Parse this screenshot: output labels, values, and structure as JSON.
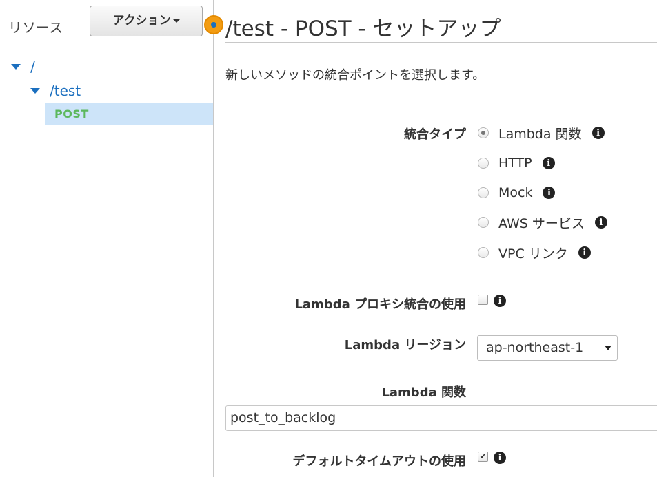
{
  "sidebar": {
    "title": "リソース",
    "action_button": "アクション",
    "tree": {
      "root": "/",
      "test": "/test",
      "post": "POST"
    }
  },
  "main": {
    "title": "/test - POST - セットアップ",
    "description": "新しいメソッドの統合ポイントを選択します。",
    "integration_type": {
      "label": "統合タイプ",
      "options": [
        "Lambda 関数",
        "HTTP",
        "Mock",
        "AWS サービス",
        "VPC リンク"
      ],
      "selected": "Lambda 関数"
    },
    "lambda_proxy": {
      "label": "Lambda プロキシ統合の使用",
      "checked": false
    },
    "lambda_region": {
      "label": "Lambda リージョン",
      "value": "ap-northeast-1"
    },
    "lambda_function": {
      "label": "Lambda 関数",
      "value": "post_to_backlog"
    },
    "default_timeout": {
      "label": "デフォルトタイムアウトの使用",
      "checked": true
    }
  },
  "colors": {
    "link": "#1b6fbf",
    "method_post": "#5cb85c",
    "selected_row": "#cde4f9",
    "marker": "#f39c12"
  },
  "icons": [
    "caret-down-icon",
    "tree-expand-icon",
    "info-icon",
    "status-marker-icon"
  ]
}
